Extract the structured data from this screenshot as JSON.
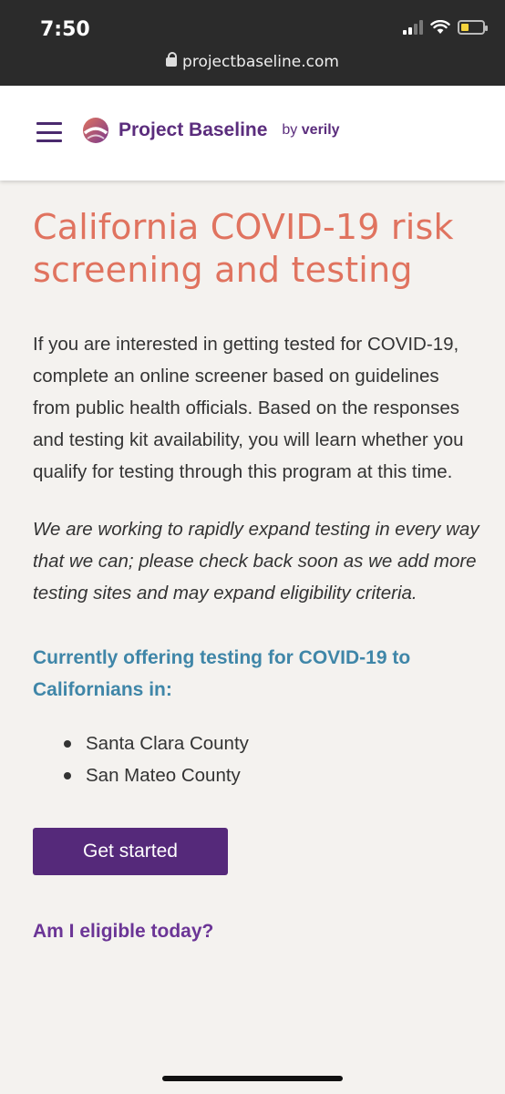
{
  "status_bar": {
    "time": "7:50",
    "url": "projectbaseline.com",
    "battery_level": 0.35,
    "battery_color": "#f5d33d"
  },
  "header": {
    "brand": "Project Baseline",
    "by": "by",
    "partner": "verily",
    "brand_color": "#5b2d7d"
  },
  "main": {
    "title": "California COVID-19 risk screening and testing",
    "intro": "If you are interested in getting tested for COVID-19, complete an online screener based on guidelines from public health officials. Based on the responses and testing kit availability, you will learn whether you qualify for testing through this program at this time.",
    "note": "We are working to rapidly expand testing in every way that we can; please check back soon as we add more testing sites and may expand eligibility criteria.",
    "offering_heading": "Currently offering testing for COVID-19 to Californians in:",
    "counties": [
      "Santa Clara County",
      "San Mateo County"
    ],
    "cta_label": "Get started",
    "eligibility_link": "Am I eligible today?"
  },
  "colors": {
    "title": "#e0735f",
    "heading": "#3f86a8",
    "button": "#55297a"
  }
}
